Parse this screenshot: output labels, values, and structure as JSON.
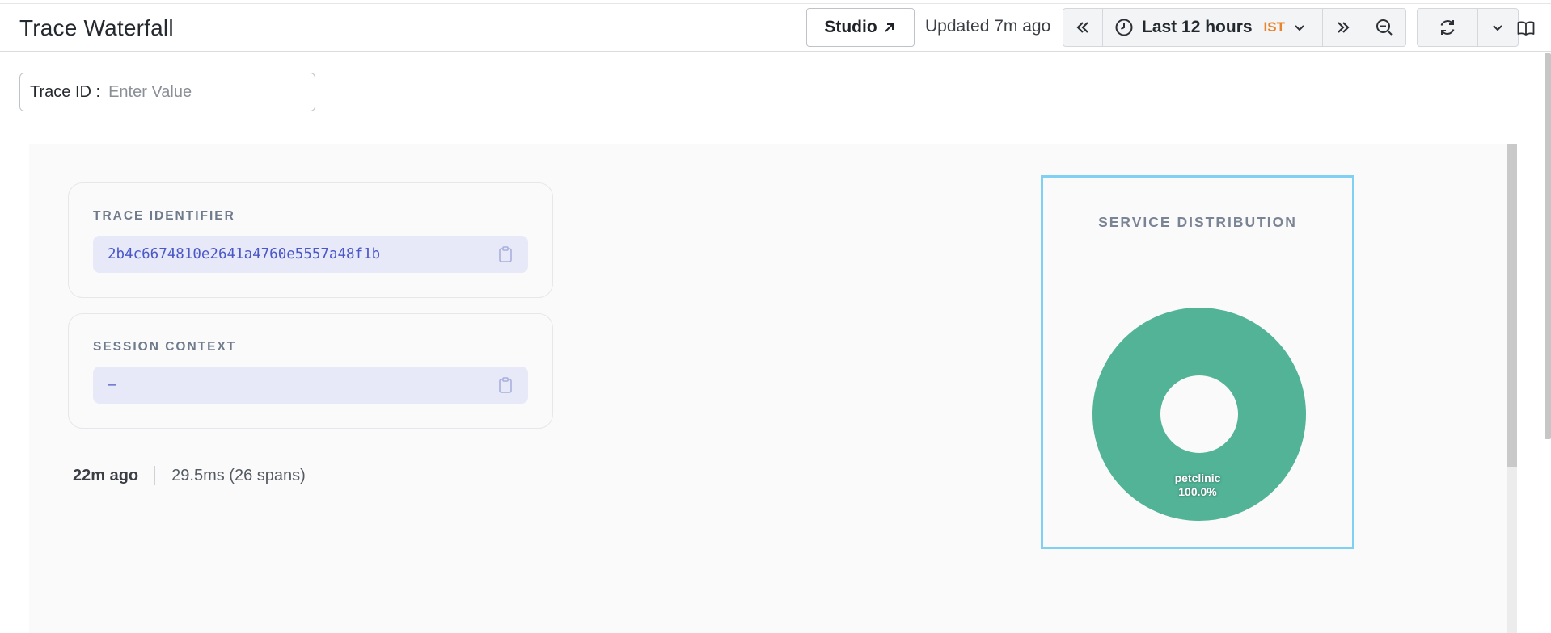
{
  "header": {
    "title": "Trace Waterfall",
    "studio_label": "Studio",
    "updated_text": "Updated 7m ago",
    "time_range": "Last 12 hours",
    "timezone": "IST",
    "icons": {
      "studio": "arrow-up-right-icon",
      "prev": "chevrons-left-icon",
      "clock": "clock-icon",
      "range_dropdown": "chevron-down-icon",
      "next": "chevrons-right-icon",
      "zoom": "zoom-out-icon",
      "refresh": "refresh-icon",
      "refresh_dropdown": "chevron-down-icon",
      "docs": "book-icon"
    }
  },
  "filter": {
    "label": "Trace ID",
    "placeholder": "Enter Value",
    "value": ""
  },
  "trace_card": {
    "heading": "TRACE IDENTIFIER",
    "value": "2b4c6674810e2641a4760e5557a48f1b",
    "copy_icon": "clipboard-icon"
  },
  "session_card": {
    "heading": "SESSION CONTEXT",
    "value": "–",
    "copy_icon": "clipboard-icon"
  },
  "meta": {
    "age": "22m ago",
    "duration": "29.5ms (26 spans)"
  },
  "service_distribution": {
    "title": "SERVICE DISTRIBUTION",
    "slices": [
      {
        "name": "petclinic",
        "percent": "100.0%",
        "fraction": 1.0,
        "color": "#52b396"
      }
    ]
  },
  "colors": {
    "accent_orange": "#e8842c",
    "id_text": "#4a57c9",
    "highlight_border": "#7fd0f2"
  }
}
